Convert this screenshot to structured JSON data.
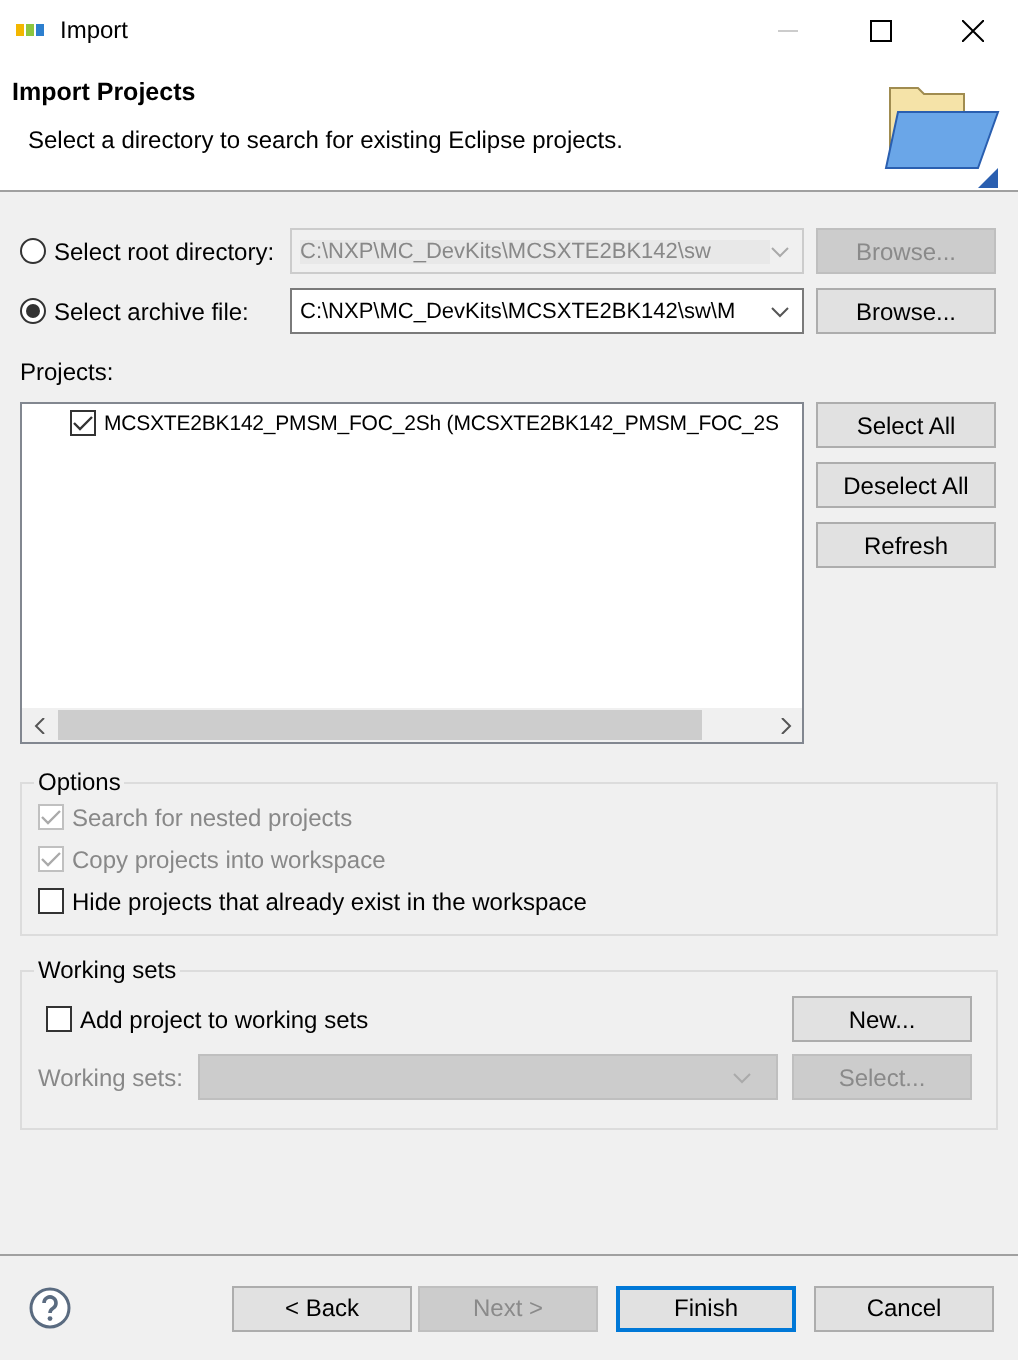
{
  "window": {
    "title": "Import"
  },
  "header": {
    "title": "Import Projects",
    "description": "Select a directory to search for existing Eclipse projects."
  },
  "sources": [
    {
      "label": "Select root directory:",
      "selected": false,
      "path": "C:\\NXP\\MC_DevKits\\MCSXTE2BK142\\sw",
      "disabled": true,
      "browse": "Browse..."
    },
    {
      "label": "Select archive file:",
      "selected": true,
      "path": "C:\\NXP\\MC_DevKits\\MCSXTE2BK142\\sw\\M",
      "disabled": false,
      "browse": "Browse..."
    }
  ],
  "projects": {
    "label": "Projects:",
    "items": [
      {
        "label": "MCSXTE2BK142_PMSM_FOC_2Sh (MCSXTE2BK142_PMSM_FOC_2S",
        "checked": true
      }
    ],
    "buttons": [
      "Select All",
      "Deselect All",
      "Refresh"
    ]
  },
  "options": {
    "title": "Options",
    "items": [
      {
        "label": "Search for nested projects",
        "checked": true,
        "disabled": true
      },
      {
        "label": "Copy projects into workspace",
        "checked": true,
        "disabled": true
      },
      {
        "label": "Hide projects that already exist in the workspace",
        "checked": false,
        "disabled": false
      }
    ]
  },
  "working_sets": {
    "title": "Working sets",
    "add_label": "Add project to working sets",
    "checked": false,
    "new_button": "New...",
    "sets_label": "Working sets:",
    "select_button": "Select...",
    "disabled": true
  },
  "footer": {
    "buttons": [
      {
        "label": "< Back",
        "disabled": false,
        "default": false
      },
      {
        "label": "Next >",
        "disabled": true,
        "default": false
      },
      {
        "label": "Finish",
        "disabled": false,
        "default": true
      },
      {
        "label": "Cancel",
        "disabled": false,
        "default": false
      }
    ]
  }
}
